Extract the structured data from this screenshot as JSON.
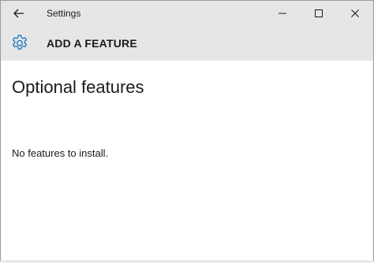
{
  "window": {
    "title": "Settings"
  },
  "header": {
    "title": "ADD A FEATURE",
    "icon": "gear-icon",
    "accent_color": "#2b78c5"
  },
  "main": {
    "page_title": "Optional features",
    "status": "No features to install."
  },
  "icons": {
    "back": "back-arrow-icon",
    "minimize": "minimize-icon",
    "maximize": "maximize-icon",
    "close": "close-icon"
  }
}
